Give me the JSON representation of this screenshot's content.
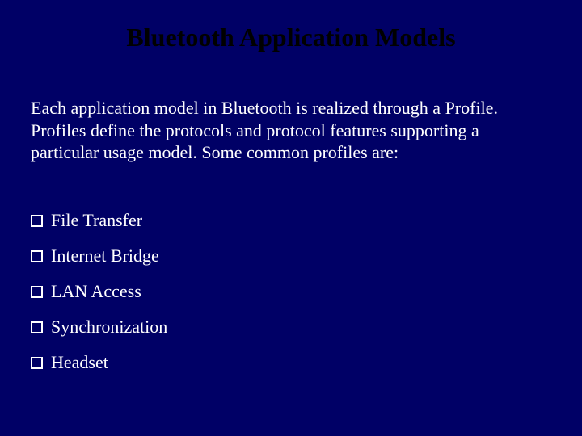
{
  "title": "Bluetooth Application Models",
  "intro": "Each application model in Bluetooth is realized through a Profile. Profiles define the protocols and protocol features supporting a particular usage model. Some common profiles are:",
  "bullets": [
    "File Transfer",
    "Internet Bridge",
    "LAN Access",
    "Synchronization",
    "Headset"
  ]
}
